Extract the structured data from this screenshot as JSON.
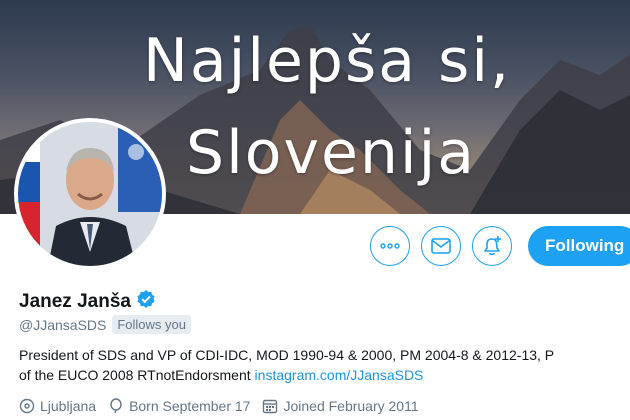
{
  "banner": {
    "line1": "Najlepša si,",
    "line2": "Slovenija"
  },
  "actions": {
    "following_label": "Following",
    "more_icon": "more-icon",
    "mail_icon": "envelope-icon",
    "bell_icon": "bell-plus-icon"
  },
  "profile": {
    "name": "Janez Janša",
    "verified": true,
    "handle": "@JJansaSDS",
    "follows_you": "Follows you",
    "bio_line1": "President of SDS and VP of CDI-IDC, MOD 1990-94 & 2000, PM 2004-8 & 2012-13, P",
    "bio_line2_text": "of the EUCO 2008 RTnotEndorsment ",
    "bio_link": "instagram.com/JJansaSDS",
    "location": "Ljubljana",
    "born": "Born September 17",
    "joined": "Joined February 2011"
  },
  "colors": {
    "accent": "#1da1f2",
    "link": "#1b95e0",
    "muted": "#657786"
  }
}
